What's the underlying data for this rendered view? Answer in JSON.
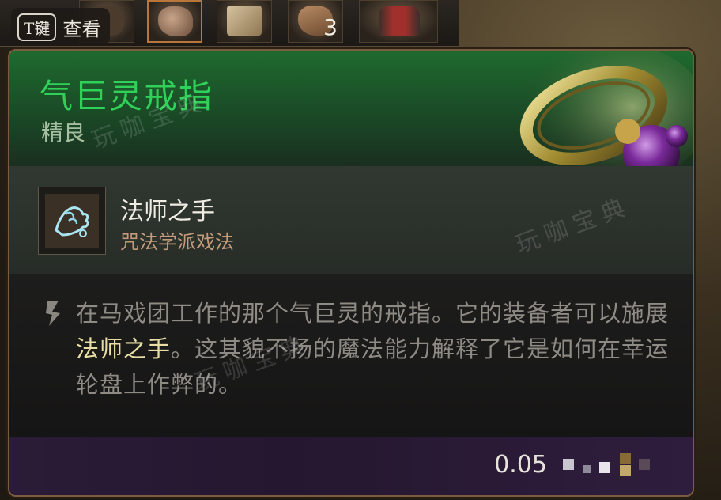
{
  "hotbar": {
    "key_hint": {
      "key": "T键",
      "action": "查看"
    },
    "slot_count": "3"
  },
  "tooltip": {
    "item_name": "气巨灵戒指",
    "rarity": "精良",
    "spell": {
      "name": "法师之手",
      "school": "咒法学派戏法"
    },
    "description": {
      "part1": "在马戏团工作的那个气巨灵的戒指。它的装备者可以施展",
      "highlight": "法师之手",
      "part2": "。这其貌不扬的魔法能力解释了它是如何在幸运轮盘上作弊的。"
    },
    "weight": "0.05"
  },
  "watermark": "玩咖宝典",
  "colors": {
    "item_name": "#2fd158",
    "rarity": "#a6bfa0",
    "spell_school": "#c39a7a",
    "desc_text": "#8e8a84",
    "highlight": "#e9dfa6",
    "frame": "#7c5c3e"
  },
  "icons": [
    "ring-icon",
    "mage-hand-icon",
    "bullet-icon",
    "keycap-icon"
  ]
}
